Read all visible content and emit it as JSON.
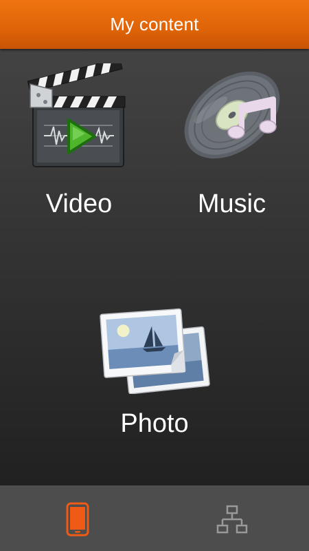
{
  "header": {
    "title": "My content"
  },
  "tiles": {
    "video": {
      "label": "Video",
      "icon": "video-clapperboard-icon"
    },
    "music": {
      "label": "Music",
      "icon": "music-disc-icon"
    },
    "photo": {
      "label": "Photo",
      "icon": "photo-stack-icon"
    }
  },
  "bottom_nav": {
    "tabs": [
      {
        "icon": "phone-icon",
        "selected": true
      },
      {
        "icon": "network-icon",
        "selected": false
      }
    ]
  },
  "colors": {
    "accent": "#e8670c",
    "nav_active": "#f05a14",
    "nav_inactive": "#9a9a9a"
  }
}
